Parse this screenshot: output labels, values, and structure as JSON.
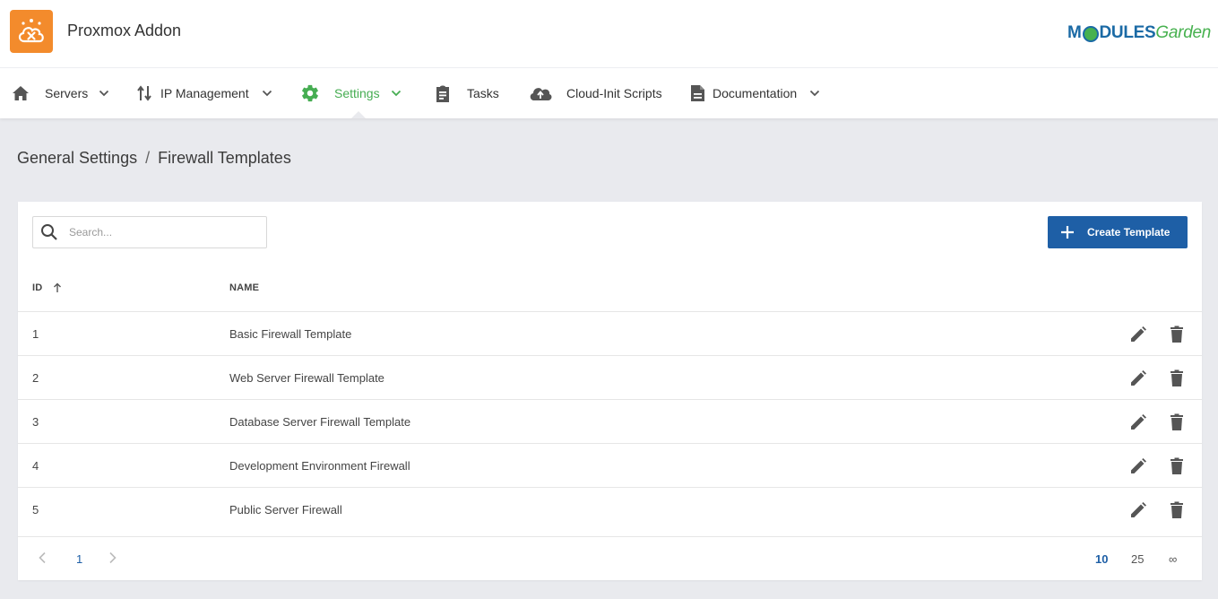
{
  "header": {
    "app_title": "Proxmox Addon",
    "brand_prefix": "M",
    "brand_suffix": "DULES",
    "brand_garden": "Garden",
    "accent_color": "#f38b2c"
  },
  "nav": {
    "items": [
      {
        "label": "Servers",
        "icon": "home-icon",
        "has_dropdown": true
      },
      {
        "label": "IP Management",
        "icon": "swap-vertical-icon",
        "has_dropdown": true
      },
      {
        "label": "Settings",
        "icon": "gear-icon",
        "has_dropdown": true,
        "active": true
      },
      {
        "label": "Tasks",
        "icon": "clipboard-icon",
        "has_dropdown": false
      },
      {
        "label": "Cloud-Init Scripts",
        "icon": "cloud-upload-icon",
        "has_dropdown": false
      },
      {
        "label": "Documentation",
        "icon": "document-icon",
        "has_dropdown": true
      }
    ],
    "active_color": "#46ad52"
  },
  "breadcrumb": {
    "parent": "General Settings",
    "separator": "/",
    "current": "Firewall Templates"
  },
  "toolbar": {
    "search_placeholder": "Search...",
    "search_value": "",
    "create_label": "Create Template",
    "button_color": "#1e5fa6"
  },
  "table": {
    "columns": [
      {
        "label": "ID",
        "sorted": "asc"
      },
      {
        "label": "NAME"
      }
    ],
    "rows": [
      {
        "id": "1",
        "name": "Basic Firewall Template"
      },
      {
        "id": "2",
        "name": "Web Server Firewall Template"
      },
      {
        "id": "3",
        "name": "Database Server Firewall Template"
      },
      {
        "id": "4",
        "name": "Development Environment Firewall"
      },
      {
        "id": "5",
        "name": "Public Server Firewall"
      }
    ]
  },
  "pagination": {
    "current_page": "1",
    "page_sizes": [
      "10",
      "25",
      "∞"
    ],
    "selected_page_size": "10"
  }
}
